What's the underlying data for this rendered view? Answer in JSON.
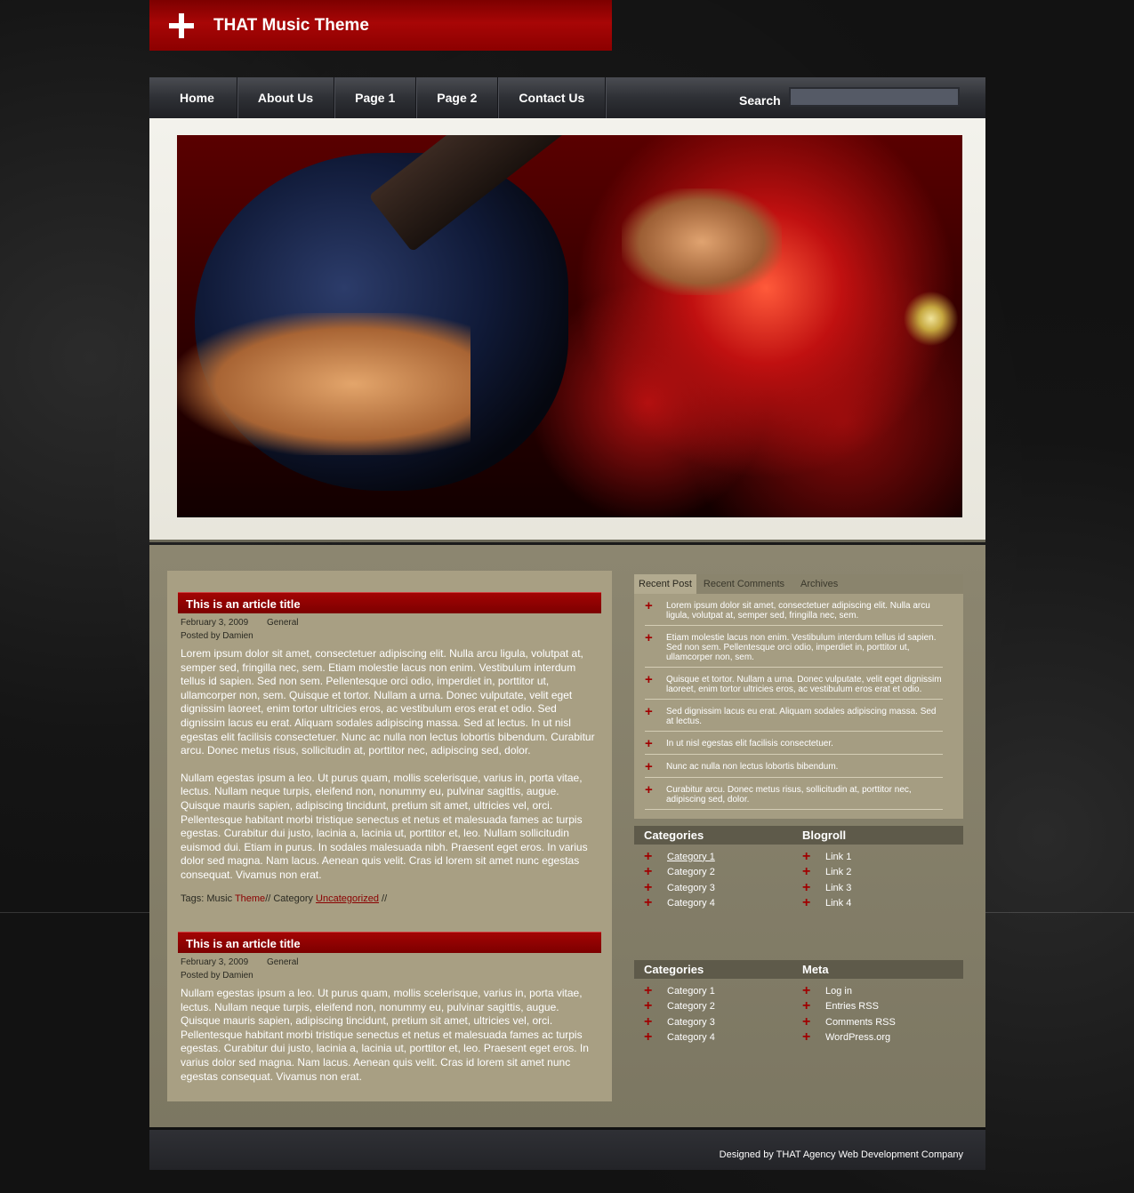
{
  "header": {
    "site_title": "THAT Music Theme"
  },
  "nav": {
    "items": [
      "Home",
      "About Us",
      "Page 1",
      "Page 2",
      "Contact Us"
    ],
    "search_label": "Search",
    "search_value": ""
  },
  "articles": [
    {
      "title": "This is an article title",
      "date": "February 3, 2009",
      "category": "General",
      "author": "Posted by Damien",
      "paragraphs": [
        "Lorem ipsum dolor sit amet, consectetuer adipiscing elit. Nulla arcu ligula, volutpat at, semper sed, fringilla nec, sem. Etiam molestie lacus non enim. Vestibulum interdum tellus id sapien. Sed non sem. Pellentesque orci odio, imperdiet in, porttitor ut, ullamcorper non, sem. Quisque et tortor. Nullam a urna. Donec vulputate, velit eget dignissim laoreet, enim tortor ultricies eros, ac vestibulum eros erat et odio. Sed dignissim lacus eu erat. Aliquam sodales adipiscing massa. Sed at lectus. In ut nisl egestas elit facilisis consectetuer. Nunc ac nulla non lectus lobortis bibendum. Curabitur arcu. Donec metus risus, sollicitudin at, porttitor nec, adipiscing sed, dolor.",
        "Nullam egestas ipsum a leo. Ut purus quam, mollis scelerisque, varius in, porta vitae, lectus. Nullam neque turpis, eleifend non, nonummy eu, pulvinar sagittis, augue. Quisque mauris sapien, adipiscing tincidunt, pretium sit amet, ultricies vel, orci. Pellentesque habitant morbi tristique senectus et netus et malesuada fames ac turpis egestas. Curabitur dui justo, lacinia a, lacinia ut, porttitor et, leo. Nullam sollicitudin euismod dui. Etiam in purus. In sodales malesuada nibh. Praesent eget eros. In varius dolor sed magna. Nam lacus. Aenean quis velit. Cras id lorem sit amet nunc egestas consequat. Vivamus non erat."
      ],
      "tags": {
        "prefix": "Tags: Music ",
        "tag_link": "Theme",
        "middle": "// Category ",
        "cat_link": "Uncategorized",
        "suffix": " //"
      }
    },
    {
      "title": "This is an article title",
      "date": "February 3, 2009",
      "category": "General",
      "author": "Posted by Damien",
      "paragraphs": [
        "Nullam egestas ipsum a leo. Ut purus quam, mollis scelerisque, varius in, porta vitae, lectus. Nullam neque turpis, eleifend non, nonummy eu, pulvinar sagittis, augue. Quisque mauris sapien, adipiscing tincidunt, pretium sit amet, ultricies vel, orci. Pellentesque habitant morbi tristique senectus et netus et malesuada fames ac turpis egestas. Curabitur dui justo, lacinia a, lacinia ut, porttitor et, leo. Praesent eget eros. In varius dolor sed magna. Nam lacus. Aenean quis velit. Cras id lorem sit amet nunc egestas consequat. Vivamus non erat."
      ]
    }
  ],
  "sidebar": {
    "tabs": [
      "Recent Post",
      "Recent Comments",
      "Archives"
    ],
    "recent_posts": [
      "Lorem ipsum dolor sit amet, consectetuer adipiscing elit. Nulla arcu ligula, volutpat at, semper sed, fringilla nec, sem.",
      "Etiam molestie lacus non enim. Vestibulum interdum tellus id sapien. Sed non sem. Pellentesque orci odio, imperdiet in, porttitor ut, ullamcorper non, sem.",
      "Quisque et tortor. Nullam a urna. Donec vulputate, velit eget dignissim laoreet, enim tortor ultricies eros, ac vestibulum eros erat et odio.",
      "Sed dignissim lacus eu erat. Aliquam sodales adipiscing massa. Sed at lectus.",
      "In ut nisl egestas elit facilisis consectetuer.",
      "Nunc ac nulla non lectus lobortis bibendum.",
      "Curabitur arcu. Donec metus risus, sollicitudin at, porttitor nec, adipiscing sed, dolor."
    ],
    "widget1": {
      "left_title": "Categories",
      "left_items": [
        "Category 1",
        "Category 2",
        "Category 3",
        "Category 4"
      ],
      "right_title": "Blogroll",
      "right_items": [
        "Link 1",
        "Link 2",
        "Link  3",
        "Link 4"
      ]
    },
    "widget2": {
      "left_title": "Categories",
      "left_items": [
        "Category 1",
        "Category 2",
        "Category 3",
        "Category 4"
      ],
      "right_title": "Meta",
      "right_items": [
        "Log in",
        "Entries RSS",
        "Comments RSS",
        "WordPress.org"
      ]
    }
  },
  "footer": {
    "credit": "Designed by THAT Agency Web Development Company"
  },
  "colors": {
    "accent_red": "#8a0000",
    "content_bg": "#a89f83",
    "nav_bg": "#2e3035"
  }
}
